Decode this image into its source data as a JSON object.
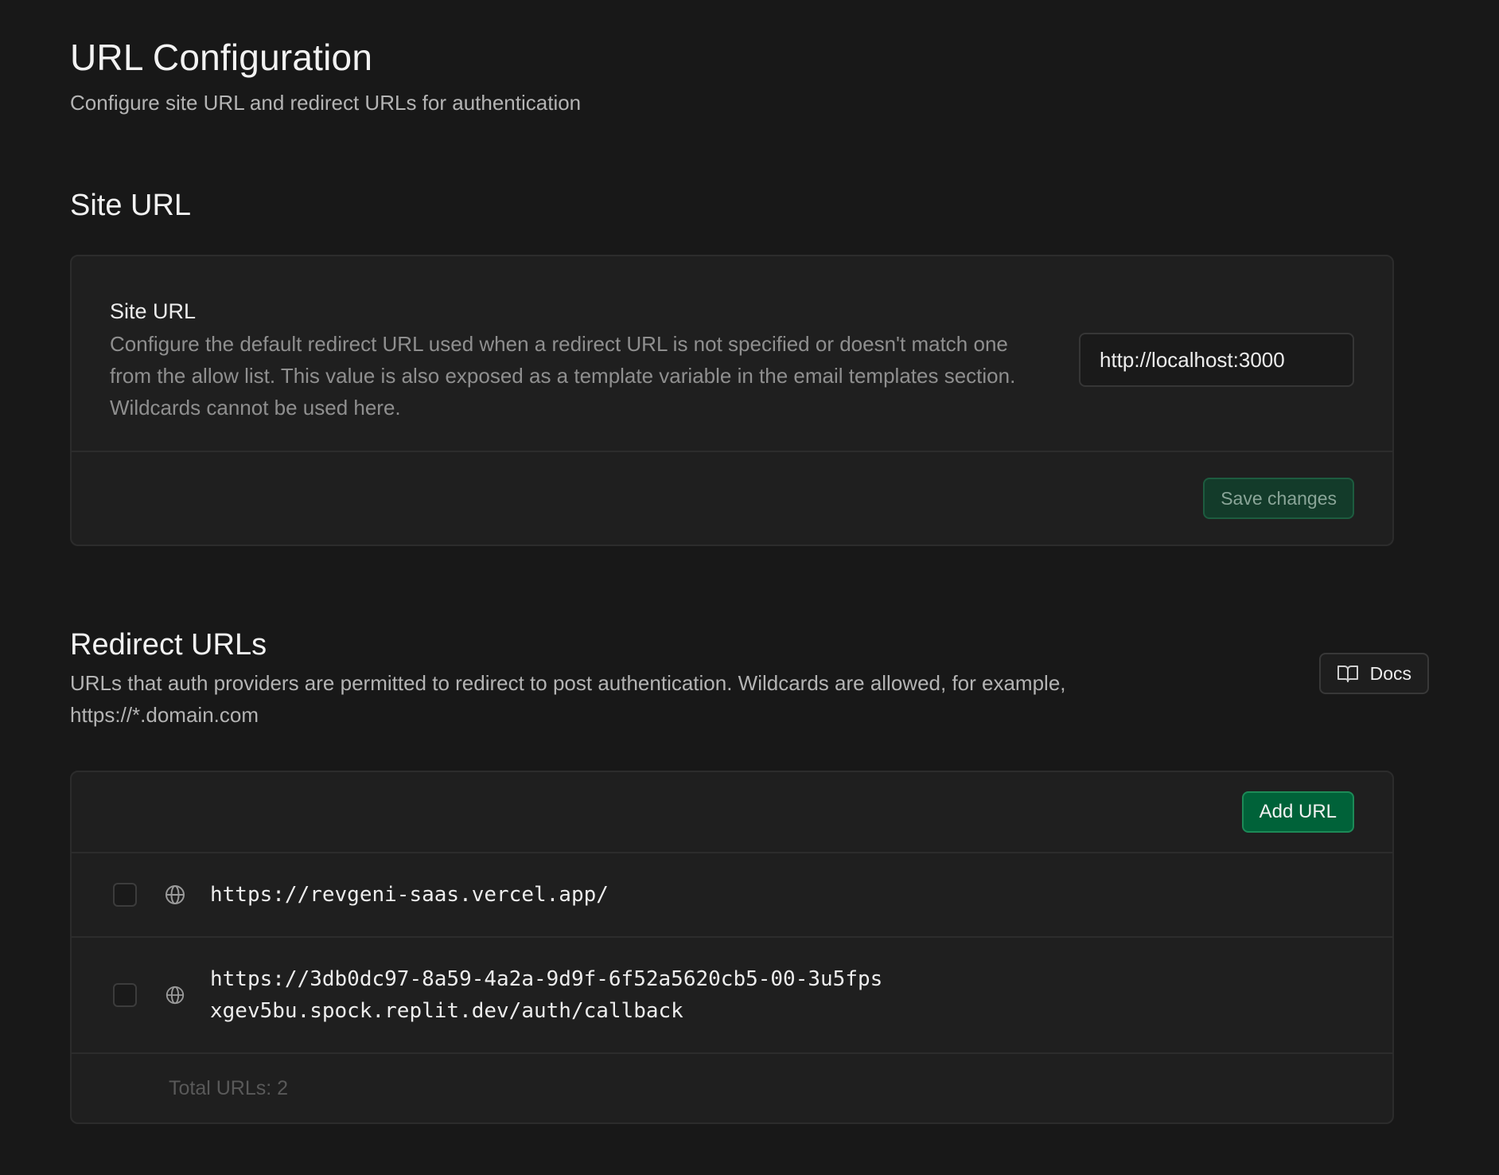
{
  "header": {
    "title": "URL Configuration",
    "subtitle": "Configure site URL and redirect URLs for authentication"
  },
  "site": {
    "section_title": "Site URL",
    "field_label": "Site URL",
    "field_description": "Configure the default redirect URL used when a redirect URL is not specified or doesn't match one from the allow list. This value is also exposed as a template variable in the email templates section. Wildcards cannot be used here.",
    "input_value": "http://localhost:3000",
    "save_label": "Save changes"
  },
  "redirect": {
    "section_title": "Redirect URLs",
    "description": "URLs that auth providers are permitted to redirect to post authentication. Wildcards are allowed, for example, https://*.domain.com",
    "docs_label": "Docs",
    "docs_icon": "book-icon",
    "add_label": "Add URL",
    "urls": [
      {
        "url": "https://revgeni-saas.vercel.app/",
        "icon": "globe-icon"
      },
      {
        "url": "https://3db0dc97-8a59-4a2a-9d9f-6f52a5620cb5-00-3u5fpsxgev5bu.spock.replit.dev/auth/callback",
        "icon": "globe-icon"
      }
    ],
    "total_label": "Total URLs: 2"
  },
  "colors": {
    "background": "#181818",
    "card": "#1f1f1f",
    "accent_green": "#006239",
    "muted_text": "#8f8f8f"
  }
}
